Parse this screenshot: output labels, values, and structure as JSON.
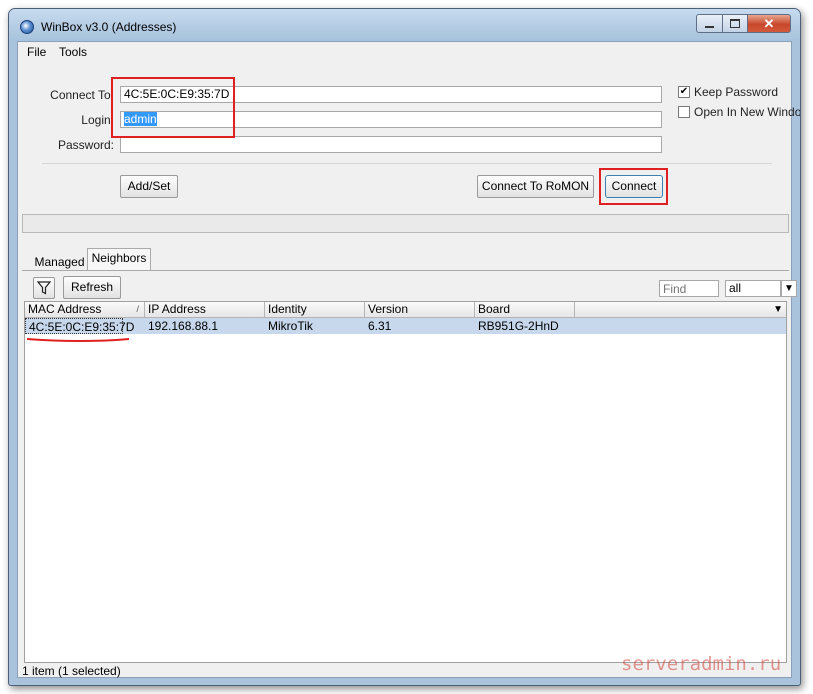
{
  "window": {
    "title": "WinBox v3.0 (Addresses)",
    "controls": {
      "minimize": "−",
      "maximize": "▫",
      "close": "✕"
    }
  },
  "menu": {
    "items": [
      "File",
      "Tools"
    ]
  },
  "form": {
    "connect_to_label": "Connect To:",
    "connect_to_value": "4C:5E:0C:E9:35:7D",
    "login_label": "Login:",
    "login_value": "admin",
    "password_label": "Password:",
    "password_value": "",
    "keep_password_label": "Keep Password",
    "keep_password_checked": true,
    "open_new_window_label": "Open In New Window",
    "open_new_window_checked": false,
    "add_set_label": "Add/Set",
    "connect_romon_label": "Connect To RoMON",
    "connect_label": "Connect"
  },
  "tabs": [
    "Managed",
    "Neighbors"
  ],
  "active_tab": "Neighbors",
  "toolbar": {
    "refresh_label": "Refresh",
    "find_placeholder": "Find",
    "filter_value": "all"
  },
  "table": {
    "columns": [
      "MAC Address",
      "IP Address",
      "Identity",
      "Version",
      "Board"
    ],
    "sort_marker": "/",
    "rows": [
      {
        "mac": "4C:5E:0C:E9:35:7D",
        "ip": "192.168.88.1",
        "identity": "MikroTik",
        "version": "6.31",
        "board": "RB951G-2HnD"
      }
    ]
  },
  "status": "1 item (1 selected)",
  "watermark": "serveradmin.ru",
  "colors": {
    "highlight": "#e02020",
    "selection": "#3399ff",
    "row_selected": "#c7d8ec"
  }
}
